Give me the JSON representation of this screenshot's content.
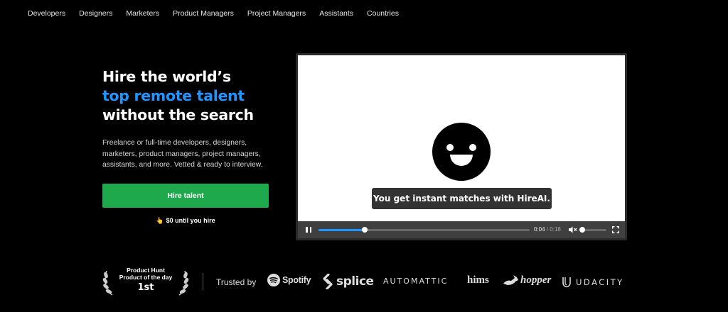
{
  "nav": {
    "items": [
      "Developers",
      "Designers",
      "Marketers",
      "Product Managers",
      "Project Managers",
      "Assistants",
      "Countries"
    ]
  },
  "hero": {
    "title_line1": "Hire the world’s",
    "title_accent": "top remote talent",
    "title_line3": "without the search",
    "description": "Freelance or full-time developers, designers, marketers, product managers, project managers, assistants, and more. Vetted & ready to interview.",
    "cta_label": "Hire talent",
    "cta_note": "$0 until you hire",
    "accent_color": "#1f95ff",
    "cta_color": "#1da94c"
  },
  "video": {
    "caption": "You get instant matches with HireAI.",
    "current_time": "0:04",
    "time_separator": "/",
    "duration": "0:18",
    "progress": 0.22,
    "volume": 0.0
  },
  "award": {
    "line1": "Product Hunt",
    "line2": "Product of the day",
    "line3": "1st"
  },
  "trusted": {
    "label": "Trusted by",
    "logos": [
      "Spotify",
      "splice",
      "AUTOMATTIC",
      "hims",
      "hopper",
      "UDACITY"
    ]
  }
}
